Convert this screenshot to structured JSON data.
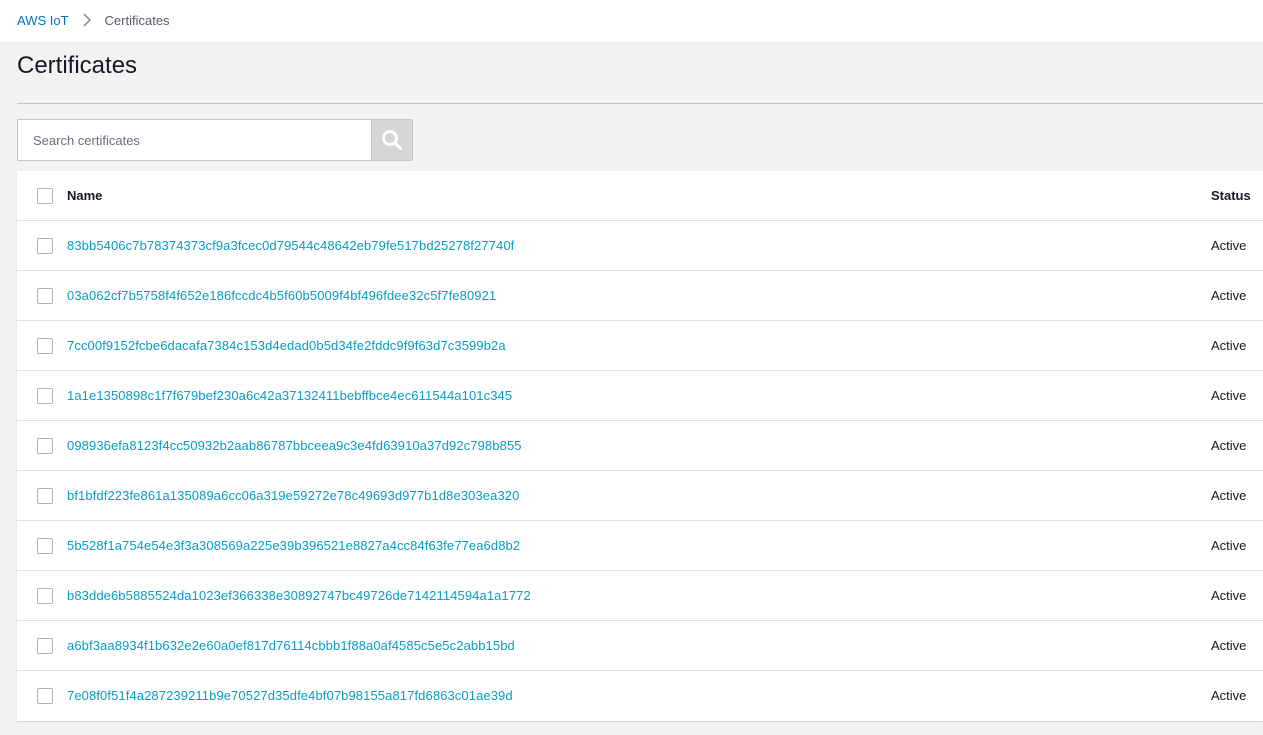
{
  "breadcrumb": {
    "root": "AWS IoT",
    "current": "Certificates"
  },
  "page": {
    "title": "Certificates"
  },
  "search": {
    "placeholder": "Search certificates",
    "value": "",
    "icon": "search-icon"
  },
  "table": {
    "columns": {
      "name": "Name",
      "status": "Status"
    },
    "rows": [
      {
        "name": "83bb5406c7b78374373cf9a3fcec0d79544c48642eb79fe517bd25278f27740f",
        "status": "Active"
      },
      {
        "name": "03a062cf7b5758f4f652e186fccdc4b5f60b5009f4bf496fdee32c5f7fe80921",
        "status": "Active"
      },
      {
        "name": "7cc00f9152fcbe6dacafa7384c153d4edad0b5d34fe2fddc9f9f63d7c3599b2a",
        "status": "Active"
      },
      {
        "name": "1a1e1350898c1f7f679bef230a6c42a37132411bebffbce4ec611544a101c345",
        "status": "Active"
      },
      {
        "name": "098936efa8123f4cc50932b2aab86787bbceea9c3e4fd63910a37d92c798b855",
        "status": "Active"
      },
      {
        "name": "bf1bfdf223fe861a135089a6cc06a319e59272e78c49693d977b1d8e303ea320",
        "status": "Active"
      },
      {
        "name": "5b528f1a754e54e3f3a308569a225e39b396521e8827a4cc84f63fe77ea6d8b2",
        "status": "Active"
      },
      {
        "name": "b83dde6b5885524da1023ef366338e30892747bc49726de7142114594a1a1772",
        "status": "Active"
      },
      {
        "name": "a6bf3aa8934f1b632e2e60a0ef817d76114cbbb1f88a0af4585c5e5c2abb15bd",
        "status": "Active"
      },
      {
        "name": "7e08f0f51f4a287239211b9e70527d35dfe4bf07b98155a817fd6863c01ae39d",
        "status": "Active"
      }
    ]
  },
  "colors": {
    "link": "#0a9cc4",
    "breadcrumb_link": "#0073bb",
    "page_background": "#f2f2f2",
    "search_button": "#d5d5d5"
  }
}
